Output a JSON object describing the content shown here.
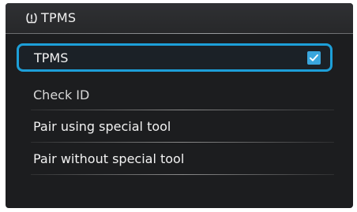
{
  "header": {
    "icon": "tire-pressure-warning-icon",
    "title": "TPMS"
  },
  "menu": {
    "items": [
      {
        "label": "TPMS",
        "checked": true,
        "selected": true
      },
      {
        "label": "Check ID"
      },
      {
        "label": "Pair using special tool"
      },
      {
        "label": "Pair without special tool"
      }
    ]
  },
  "colors": {
    "accent": "#1d9fd8",
    "background": "#1c1d1f",
    "header": "#2f3033"
  }
}
